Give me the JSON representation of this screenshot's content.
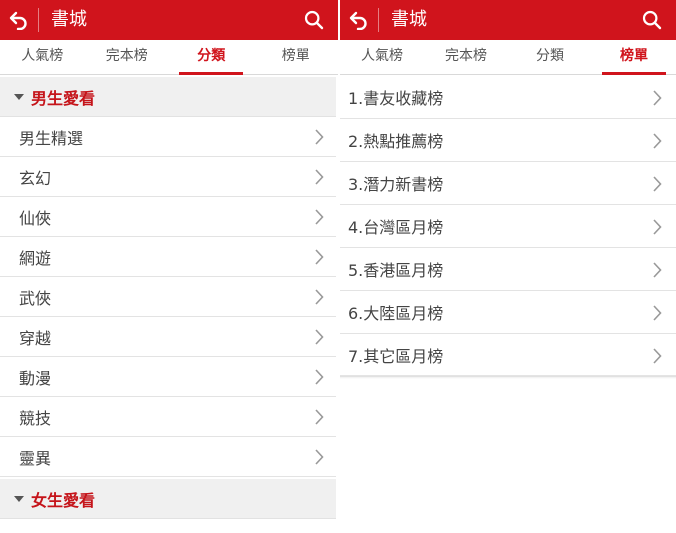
{
  "left": {
    "header": {
      "title": "書城"
    },
    "tabs": [
      {
        "label": "人氣榜"
      },
      {
        "label": "完本榜"
      },
      {
        "label": "分類"
      },
      {
        "label": "榜單"
      }
    ],
    "active_tab": "分類",
    "sections": [
      {
        "title": "男生愛看",
        "items": [
          {
            "label": "男生精選"
          },
          {
            "label": "玄幻"
          },
          {
            "label": "仙俠"
          },
          {
            "label": "網遊"
          },
          {
            "label": "武俠"
          },
          {
            "label": "穿越"
          },
          {
            "label": "動漫"
          },
          {
            "label": "競技"
          },
          {
            "label": "靈異"
          }
        ]
      },
      {
        "title": "女生愛看",
        "items": []
      }
    ]
  },
  "right": {
    "header": {
      "title": "書城"
    },
    "tabs": [
      {
        "label": "人氣榜"
      },
      {
        "label": "完本榜"
      },
      {
        "label": "分類"
      },
      {
        "label": "榜單"
      }
    ],
    "active_tab": "榜單",
    "rankings": [
      {
        "label": "1.書友收藏榜"
      },
      {
        "label": "2.熱點推薦榜"
      },
      {
        "label": "3.潛力新書榜"
      },
      {
        "label": "4.台灣區月榜"
      },
      {
        "label": "5.香港區月榜"
      },
      {
        "label": "6.大陸區月榜"
      },
      {
        "label": "7.其它區月榜"
      }
    ]
  },
  "icons": {
    "back": "back-arrow-icon",
    "search": "search-icon",
    "chevron": "chevron-right-icon",
    "caret": "caret-down-icon"
  },
  "colors": {
    "accent": "#d0141c",
    "section_title": "#c5141a",
    "section_bg": "#f0f0f0"
  }
}
